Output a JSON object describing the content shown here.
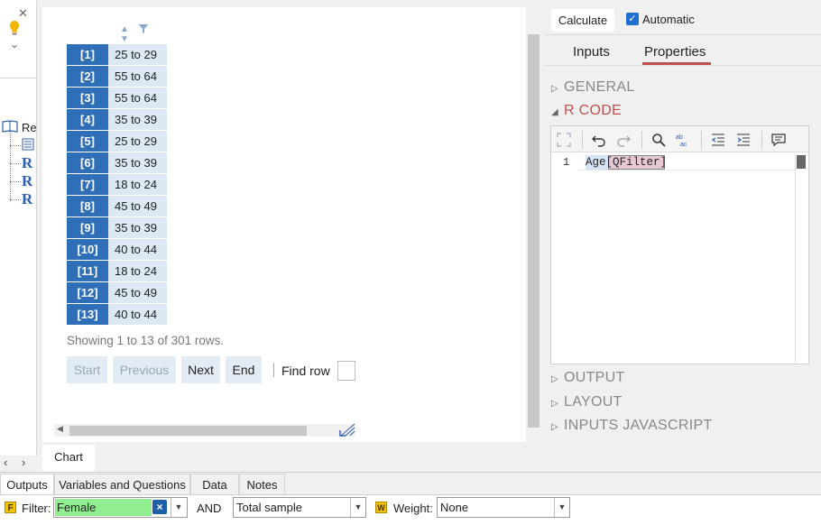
{
  "table": {
    "rows": [
      {
        "index": "[1]",
        "value": "25 to 29"
      },
      {
        "index": "[2]",
        "value": "55 to 64"
      },
      {
        "index": "[3]",
        "value": "55 to 64"
      },
      {
        "index": "[4]",
        "value": "35 to 39"
      },
      {
        "index": "[5]",
        "value": "25 to 29"
      },
      {
        "index": "[6]",
        "value": "35 to 39"
      },
      {
        "index": "[7]",
        "value": "18 to 24"
      },
      {
        "index": "[8]",
        "value": "45 to 49"
      },
      {
        "index": "[9]",
        "value": "35 to 39"
      },
      {
        "index": "[10]",
        "value": "40 to 44"
      },
      {
        "index": "[11]",
        "value": "18 to 24"
      },
      {
        "index": "[12]",
        "value": "45 to 49"
      },
      {
        "index": "[13]",
        "value": "40 to 44"
      }
    ],
    "showing_text": "Showing 1 to 13 of 301 rows.",
    "nav": {
      "start": "Start",
      "previous": "Previous",
      "next": "Next",
      "end": "End"
    },
    "find_row_label": "Find row"
  },
  "left_panel": {
    "close_glyph": "✕",
    "chevron_glyph": "⌄",
    "tree_root_label": "Re",
    "arrows": "‹ ›"
  },
  "chart_tab": {
    "label": "Chart"
  },
  "right_panel": {
    "calculate_label": "Calculate",
    "automatic_label": "Automatic",
    "automatic_checked": true,
    "tabs": [
      {
        "label": "Inputs"
      },
      {
        "label": "Properties"
      }
    ],
    "active_tab": "Properties",
    "sections": {
      "general": "GENERAL",
      "r_code": "R CODE",
      "output": "OUTPUT",
      "layout": "LAYOUT",
      "inputs_js": "INPUTS JAVASCRIPT"
    },
    "editor": {
      "line_number": "1",
      "code_prefix": "Age",
      "code_bracket_open": "[",
      "code_arg": "QFilter",
      "code_bracket_close": "]"
    }
  },
  "bottom_tabs": [
    {
      "label": "Outputs"
    },
    {
      "label": "Variables and Questions"
    },
    {
      "label": "Data"
    },
    {
      "label": "Notes"
    }
  ],
  "filter_bar": {
    "filter_icon_letter": "F",
    "filter_label": "Filter:",
    "filter_value": "Female",
    "and_label": "AND",
    "sample_value": "Total sample",
    "weight_icon_letter": "W",
    "weight_label": "Weight:",
    "weight_value": "None"
  },
  "colors": {
    "index_cell": "#2f6fb8",
    "value_cell": "#dce9f5",
    "accent_red": "#c0504d",
    "filter_highlight": "#90ee90"
  }
}
